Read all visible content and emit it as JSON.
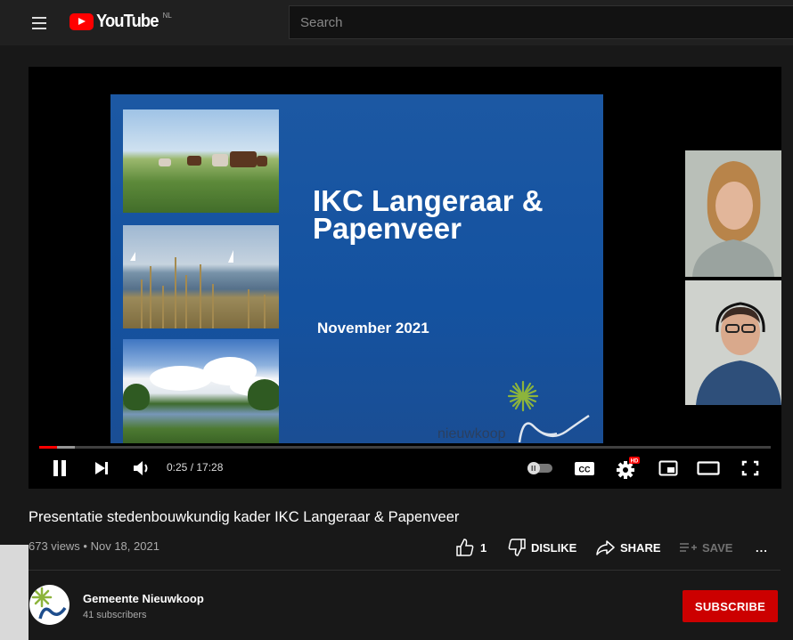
{
  "header": {
    "logo_text": "YouTube",
    "country_code": "NL",
    "search_placeholder": "Search"
  },
  "player": {
    "slide": {
      "title": "IKC Langeraar &\nPapenveer",
      "date": "November 2021",
      "brand": "nieuwkoop"
    },
    "time_current": "0:25",
    "time_separator": " / ",
    "time_total": "17:28",
    "played_fraction": 0.024,
    "buffered_fraction": 0.049,
    "cc_label": "CC",
    "hd_badge": "HD",
    "icons": [
      "pause-icon",
      "next-icon",
      "volume-icon",
      "autoplay-toggle",
      "cc-icon",
      "settings-icon",
      "miniplayer-icon",
      "theater-icon",
      "fullscreen-icon"
    ]
  },
  "video": {
    "title": "Presentatie stedenbouwkundig kader IKC Langeraar & Papenveer",
    "views": "673 views",
    "dot": " • ",
    "date": "Nov 18, 2021"
  },
  "actions": {
    "like_count": "1",
    "dislike_label": "DISLIKE",
    "share_label": "SHARE",
    "save_label": "SAVE",
    "more_label": "..."
  },
  "channel": {
    "name": "Gemeente Nieuwkoop",
    "subscribers": "41 subscribers"
  },
  "subscribe_label": "SUBSCRIBE",
  "colors": {
    "background": "#181818",
    "topbar": "#202020",
    "accent_red": "#ff0000",
    "subscribe_red": "#cc0000",
    "slide_blue": "#1452a0",
    "brand_green": "#8cb43c"
  }
}
